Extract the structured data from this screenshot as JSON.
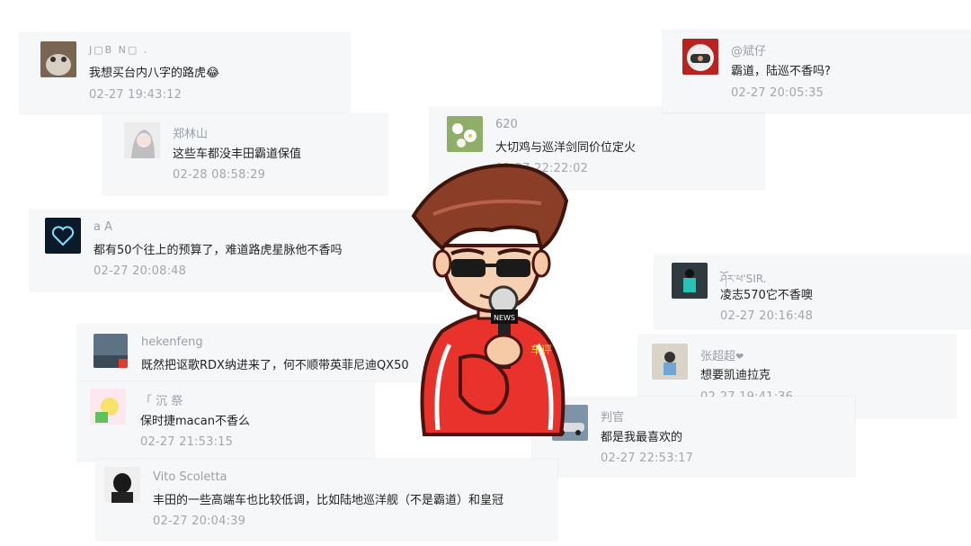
{
  "comments": [
    {
      "name": "J▢B N▢ .",
      "text": "我想买台内八字的路虎",
      "emoji": "😂",
      "time": "02-27 19:43:12"
    },
    {
      "name": "郑林山",
      "text": "这些车都没丰田霸道保值",
      "time": "02-28 08:58:29"
    },
    {
      "name": "620",
      "text": "大切鸡与巡洋剑同价位定火",
      "time": "02-27 22:22:02"
    },
    {
      "name": "@斌仔",
      "text": "霸道，陆巡不香吗?",
      "time": "02-27 20:05:35"
    },
    {
      "name": "a A",
      "text": "都有50个往上的预算了，难道路虎星脉他不香吗",
      "time": "02-27 20:08:48"
    },
    {
      "name": "ཤོར་ཕ'SIR.",
      "text": "凌志570它不香噢",
      "time": "02-27 20:16:48"
    },
    {
      "name": "hekenfeng",
      "text": "既然把讴歌RDX纳进来了，何不顺带英菲尼迪QX50",
      "time": ""
    },
    {
      "name": "张超超",
      "text": "想要凯迪拉克",
      "time": "02-27 19:41:36"
    },
    {
      "name": "「 沉 祭",
      "text": "保时捷macan不香么",
      "time": "02-27 21:53:15"
    },
    {
      "name": "判官",
      "text": "都是我最喜欢的",
      "time": "02-27 22:53:17"
    },
    {
      "name": "Vito Scoletta",
      "text": "丰田的一些高端车也比较低调，比如陆地巡洋舰（不是霸道）和皇冠",
      "time": "02-27 20:04:39"
    }
  ],
  "mascot": {
    "mic_label": "NEWS",
    "jacket_label": "车评"
  },
  "colors": {
    "card_bg": "#f6f7f9",
    "name": "#9aa0a8",
    "text": "#222222",
    "time": "#a2a7ae",
    "jacket": "#e8322b"
  }
}
